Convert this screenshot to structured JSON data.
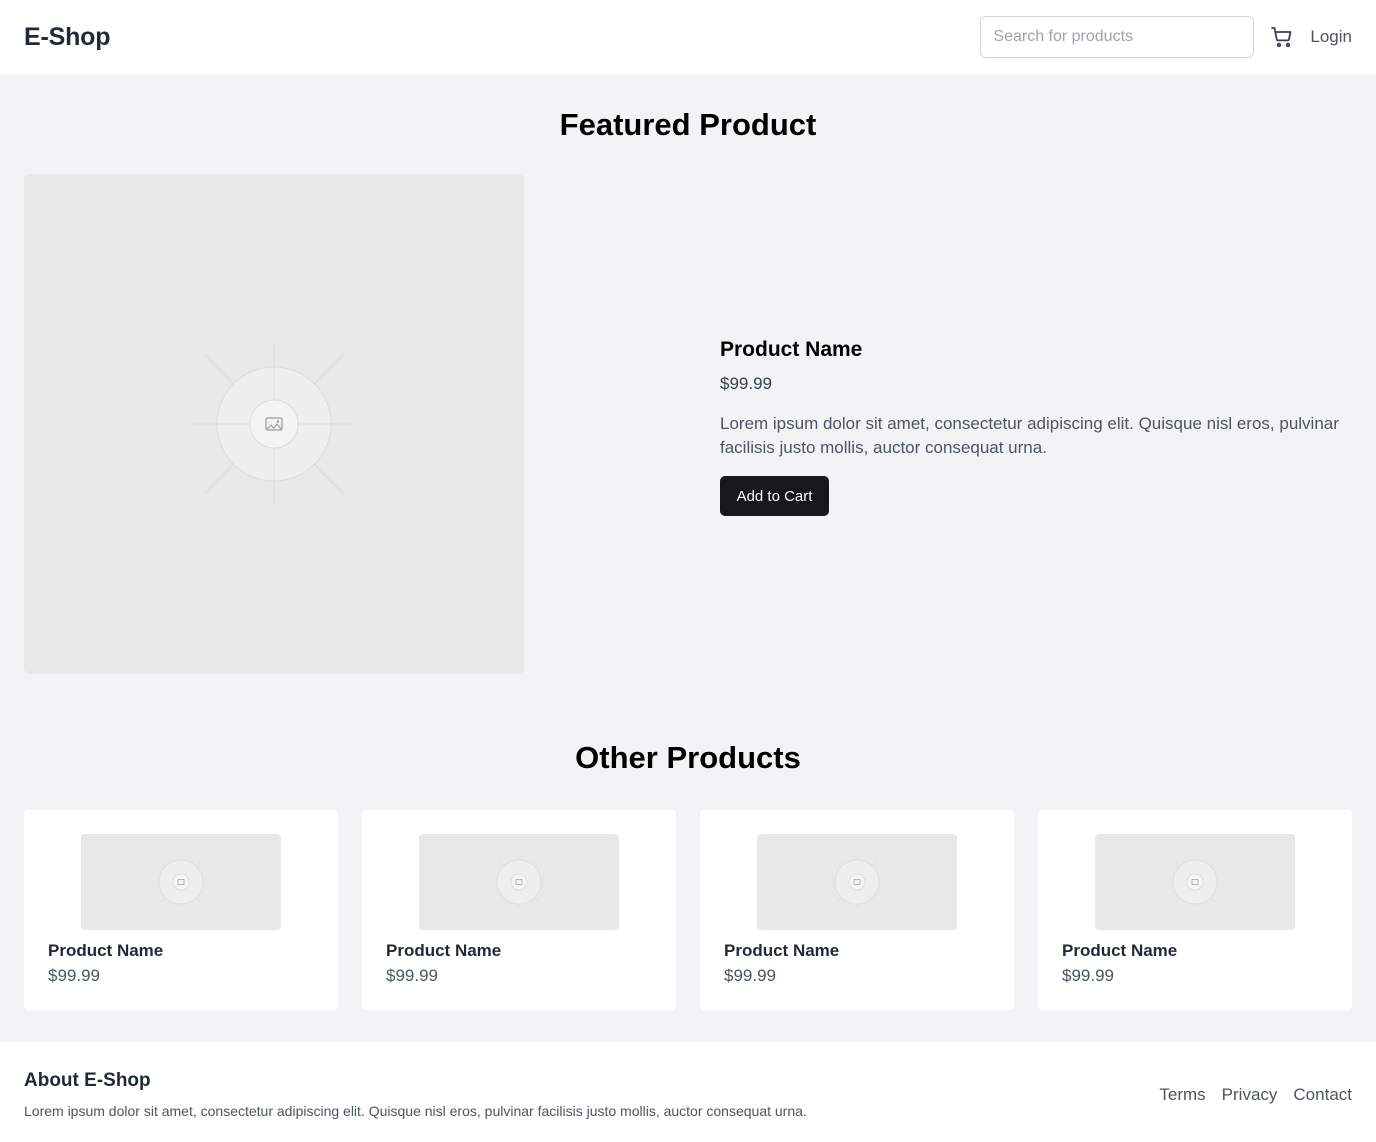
{
  "header": {
    "logo": "E-Shop",
    "search_placeholder": "Search for products",
    "cart_icon": "cart-icon",
    "login_label": "Login"
  },
  "featured": {
    "title": "Featured Product",
    "image_icon": "image-placeholder-icon",
    "name": "Product Name",
    "price": "$99.99",
    "description": "Lorem ipsum dolor sit amet, consectetur adipiscing elit. Quisque nisl eros, pulvinar facilisis justo mollis, auctor consequat urna.",
    "button_label": "Add to Cart"
  },
  "other": {
    "title": "Other Products",
    "products": [
      {
        "name": "Product Name",
        "price": "$99.99"
      },
      {
        "name": "Product Name",
        "price": "$99.99"
      },
      {
        "name": "Product Name",
        "price": "$99.99"
      },
      {
        "name": "Product Name",
        "price": "$99.99"
      }
    ]
  },
  "footer": {
    "title": "About E-Shop",
    "text": "Lorem ipsum dolor sit amet, consectetur adipiscing elit. Quisque nisl eros, pulvinar facilisis justo mollis, auctor consequat urna.",
    "links": [
      "Terms",
      "Privacy",
      "Contact"
    ]
  },
  "colors": {
    "page_background": "#f2f3f5",
    "button": "#18181b",
    "placeholder": "#e8e8e8"
  }
}
